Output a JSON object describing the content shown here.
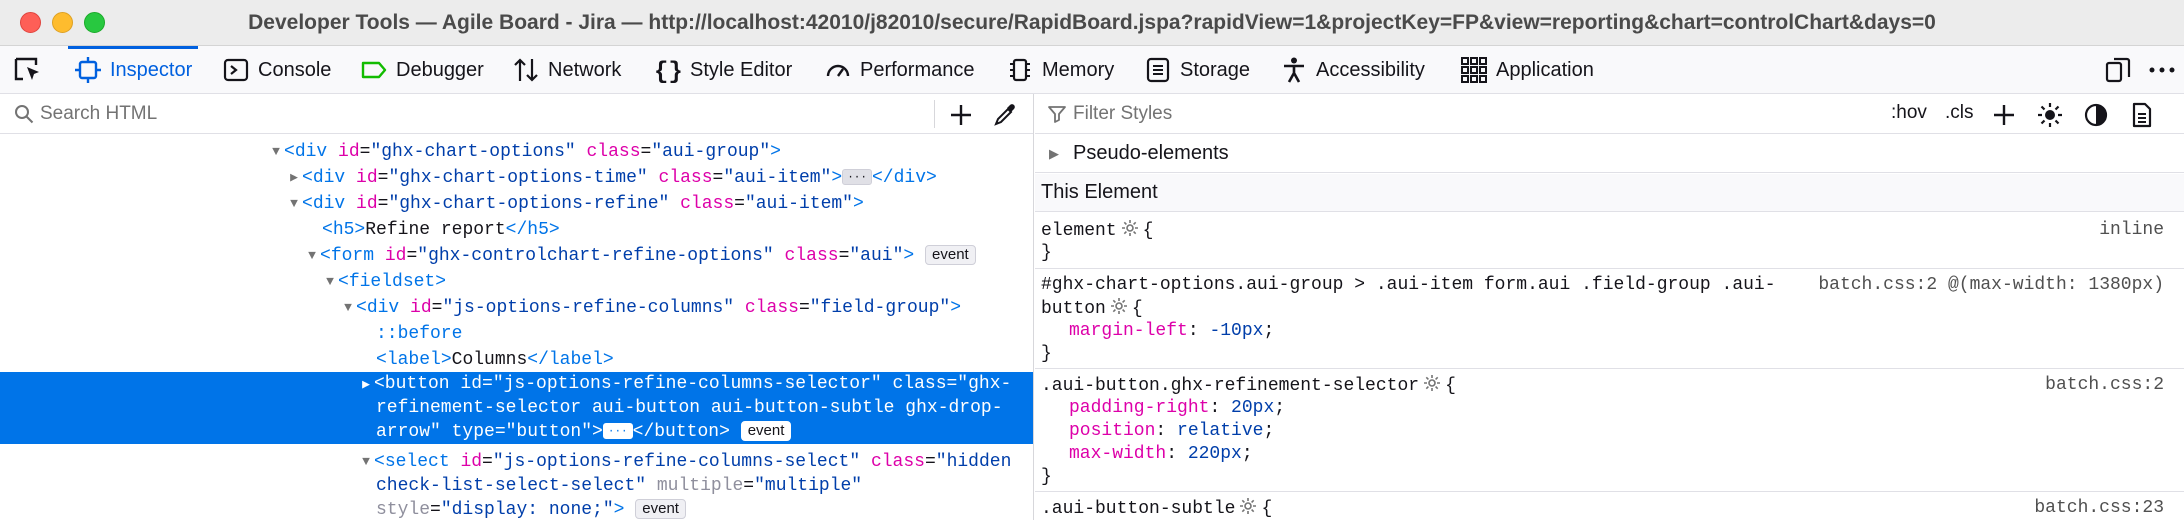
{
  "window": {
    "title": "Developer Tools — Agile Board - Jira — http://localhost:42010/j82010/secure/RapidBoard.jspa?rapidView=1&projectKey=FP&view=reporting&chart=controlChart&days=0"
  },
  "toolbox": {
    "tabs": [
      {
        "label": "Inspector",
        "icon": "inspector-icon",
        "selected": true
      },
      {
        "label": "Console",
        "icon": "console-icon"
      },
      {
        "label": "Debugger",
        "icon": "debugger-icon"
      },
      {
        "label": "Network",
        "icon": "network-icon"
      },
      {
        "label": "Style Editor",
        "icon": "style-editor-icon"
      },
      {
        "label": "Performance",
        "icon": "performance-icon"
      },
      {
        "label": "Memory",
        "icon": "memory-icon"
      },
      {
        "label": "Storage",
        "icon": "storage-icon"
      },
      {
        "label": "Accessibility",
        "icon": "accessibility-icon"
      },
      {
        "label": "Application",
        "icon": "application-icon"
      }
    ]
  },
  "inspector": {
    "search_placeholder": "Search HTML",
    "markup": {
      "n1": {
        "tag": "div",
        "a1n": "id",
        "a1v": "\"ghx-chart-options\"",
        "a2n": "class",
        "a2v": "\"aui-group\""
      },
      "n2": {
        "tag": "div",
        "a1n": "id",
        "a1v": "\"ghx-chart-options-time\"",
        "a2n": "class",
        "a2v": "\"aui-item\"",
        "close": "div"
      },
      "n3": {
        "tag": "div",
        "a1n": "id",
        "a1v": "\"ghx-chart-options-refine\"",
        "a2n": "class",
        "a2v": "\"aui-item\""
      },
      "n4": {
        "tag": "h5",
        "text": "Refine report",
        "close": "h5"
      },
      "n5": {
        "tag": "form",
        "a1n": "id",
        "a1v": "\"ghx-controlchart-refine-options\"",
        "a2n": "class",
        "a2v": "\"aui\"",
        "badge": "event"
      },
      "n6": {
        "tag": "fieldset"
      },
      "n7": {
        "tag": "div",
        "a1n": "id",
        "a1v": "\"js-options-refine-columns\"",
        "a2n": "class",
        "a2v": "\"field-group\""
      },
      "n8": {
        "pseudo": "::before"
      },
      "n9": {
        "tag": "label",
        "text": "Columns",
        "close": "label"
      },
      "n10": {
        "line1": "<button id=\"js-options-refine-columns-selector\" class=\"ghx-",
        "line2": "refinement-selector aui-button aui-button-subtle ghx-drop-",
        "line3a": "arrow\" type=\"button\">",
        "line3b": "</button>",
        "badge": "event"
      },
      "n11": {
        "tag": "select",
        "a1n": "id",
        "a1v": "\"js-options-refine-columns-select\"",
        "a2n": "class",
        "a2v_part1": "\"hidden",
        "a2v_part2": "check-list-select-select\"",
        "a3n": "multiple",
        "a3v": "\"multiple\"",
        "a4n": "style",
        "a4v": "\"display: none;\"",
        "badge": "event"
      }
    }
  },
  "rules": {
    "filter_placeholder": "Filter Styles",
    "hov": ":hov",
    "cls": ".cls",
    "pseudo_elements": "Pseudo-elements",
    "this_element": "This Element",
    "r1": {
      "selector": "element",
      "source": "inline"
    },
    "r2": {
      "selector_l1": "#ghx-chart-options.aui-group > .aui-item form.aui .field-group .aui-",
      "selector_l2": "button",
      "source": "batch.css:2 @(max-width: 1380px)",
      "props": [
        {
          "name": "margin-left",
          "value": "-10px"
        }
      ]
    },
    "r3": {
      "selector": ".aui-button.ghx-refinement-selector",
      "source": "batch.css:2",
      "props": [
        {
          "name": "padding-right",
          "value": "20px"
        },
        {
          "name": "position",
          "value": "relative"
        },
        {
          "name": "max-width",
          "value": "220px"
        }
      ]
    },
    "r4": {
      "selector": ".aui-button-subtle",
      "source": "batch.css:23"
    }
  }
}
